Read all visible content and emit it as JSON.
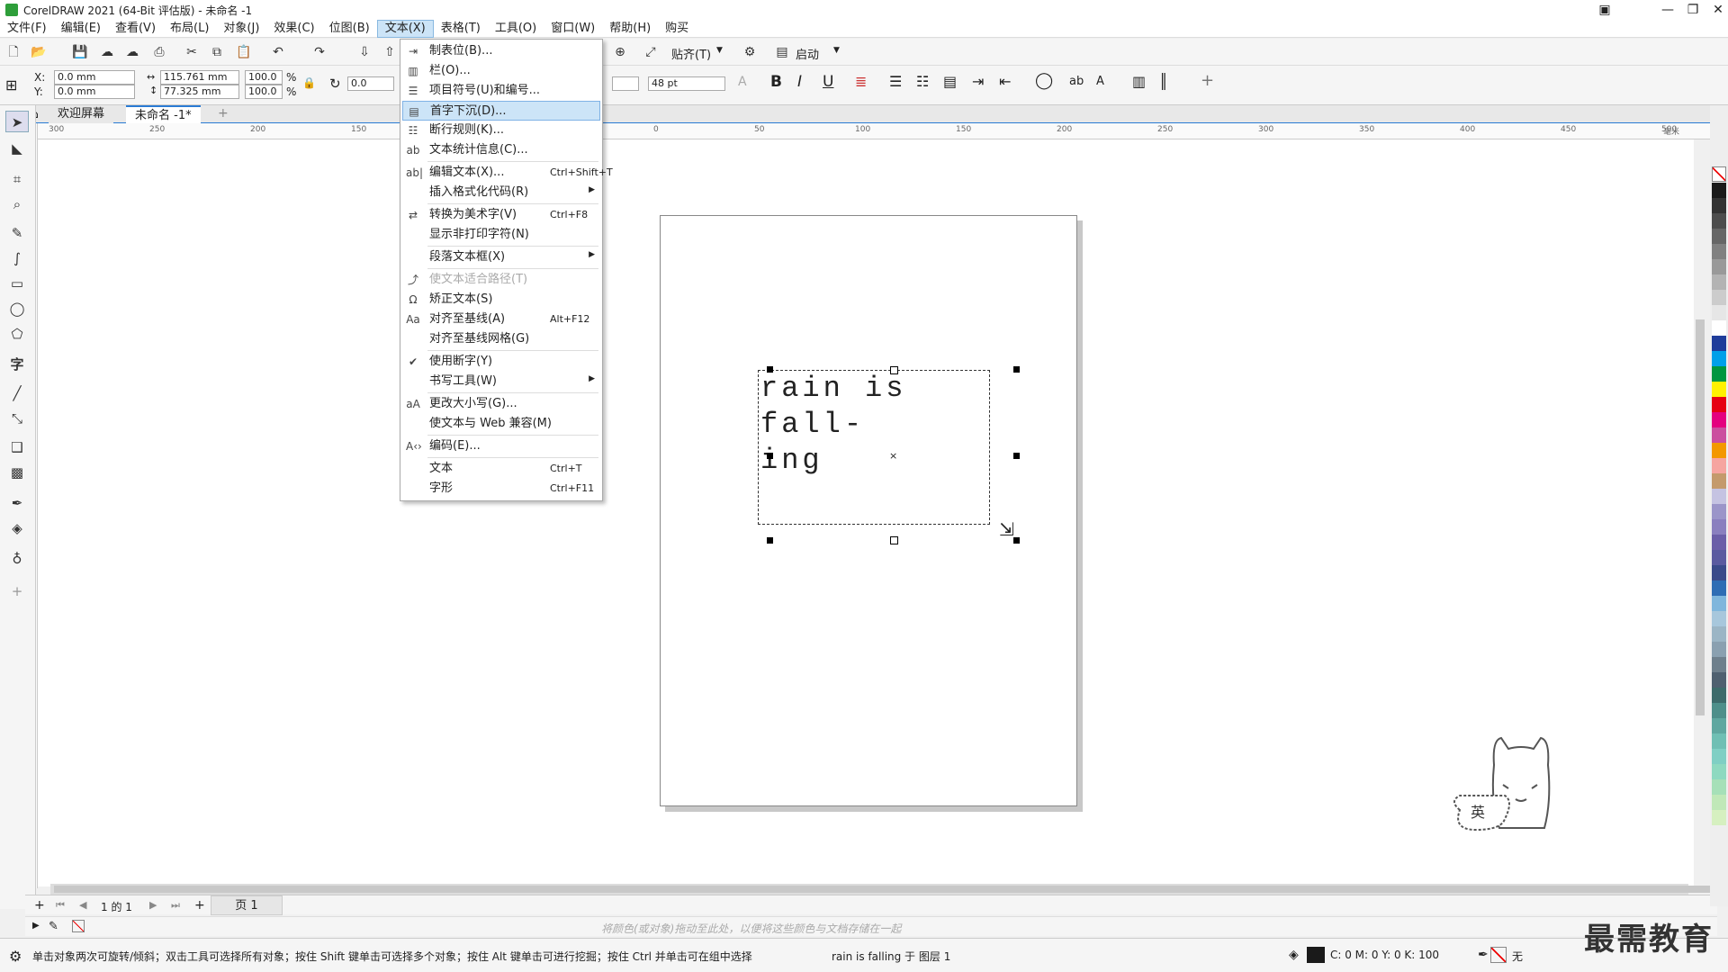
{
  "window": {
    "title": "CorelDRAW 2021 (64-Bit 评估版) - 未命名 -1"
  },
  "menubar": [
    "文件(F)",
    "编辑(E)",
    "查看(V)",
    "布局(L)",
    "对象(J)",
    "效果(C)",
    "位图(B)",
    "文本(X)",
    "表格(T)",
    "工具(O)",
    "窗口(W)",
    "帮助(H)",
    "购买"
  ],
  "toolbar": {
    "snap_label": "贴齐(T)",
    "launch_label": "启动"
  },
  "propbar": {
    "x_label": "X:",
    "x_value": "0.0 mm",
    "y_label": "Y:",
    "y_value": "0.0 mm",
    "w_value": "115.761 mm",
    "h_value": "77.325 mm",
    "sx": "100.0",
    "sy": "100.0",
    "pct": "%",
    "angle": "0.0",
    "font_size": "48 pt"
  },
  "tabs": {
    "welcome": "欢迎屏幕",
    "doc": "未命名 -1*"
  },
  "ruler": {
    "h": [
      "300",
      "250",
      "200",
      "150",
      "100",
      "50",
      "0",
      "50",
      "100",
      "150",
      "200",
      "250",
      "300",
      "350",
      "400",
      "450",
      "500"
    ],
    "unit": "毫米"
  },
  "canvas": {
    "text_lines": [
      "rain is fall-",
      "ing"
    ]
  },
  "dropdown": {
    "items": [
      {
        "label": "制表位(B)...",
        "icon": "tab-icon",
        "sc": "",
        "sub": false,
        "dis": false,
        "check": false,
        "hl": false
      },
      {
        "label": "栏(O)...",
        "icon": "columns-icon",
        "sc": "",
        "sub": false,
        "dis": false,
        "check": false,
        "hl": false
      },
      {
        "label": "项目符号(U)和编号...",
        "icon": "bullet-icon",
        "sc": "",
        "sub": false,
        "dis": false,
        "check": false,
        "hl": false
      },
      {
        "label": "首字下沉(D)...",
        "icon": "dropcap-icon",
        "sc": "",
        "sub": false,
        "dis": false,
        "check": false,
        "hl": true
      },
      {
        "label": "断行规则(K)...",
        "icon": "linebreak-icon",
        "sc": "",
        "sub": false,
        "dis": false,
        "check": false,
        "hl": false
      },
      {
        "label": "文本统计信息(C)...",
        "icon": "stats-icon",
        "sc": "",
        "sub": false,
        "dis": false,
        "check": false,
        "hl": false
      },
      {
        "label": "编辑文本(X)...",
        "icon": "edit-text-icon",
        "sc": "Ctrl+Shift+T",
        "sub": false,
        "dis": false,
        "check": false,
        "hl": false
      },
      {
        "label": "插入格式化代码(R)",
        "icon": "",
        "sc": "",
        "sub": true,
        "dis": false,
        "check": false,
        "hl": false
      },
      {
        "label": "转换为美术字(V)",
        "icon": "convert-icon",
        "sc": "Ctrl+F8",
        "sub": false,
        "dis": false,
        "check": false,
        "hl": false
      },
      {
        "label": "显示非打印字符(N)",
        "icon": "",
        "sc": "",
        "sub": false,
        "dis": false,
        "check": false,
        "hl": false
      },
      {
        "label": "段落文本框(X)",
        "icon": "",
        "sc": "",
        "sub": true,
        "dis": false,
        "check": false,
        "hl": false
      },
      {
        "label": "使文本适合路径(T)",
        "icon": "fit-path-icon",
        "sc": "",
        "sub": false,
        "dis": true,
        "check": false,
        "hl": false
      },
      {
        "label": "矫正文本(S)",
        "icon": "straighten-icon",
        "sc": "",
        "sub": false,
        "dis": false,
        "check": false,
        "hl": false
      },
      {
        "label": "对齐至基线(A)",
        "icon": "baseline-icon",
        "sc": "Alt+F12",
        "sub": false,
        "dis": false,
        "check": false,
        "hl": false
      },
      {
        "label": "对齐至基线网格(G)",
        "icon": "",
        "sc": "",
        "sub": false,
        "dis": false,
        "check": false,
        "hl": false
      },
      {
        "label": "使用断字(Y)",
        "icon": "",
        "sc": "",
        "sub": false,
        "dis": false,
        "check": true,
        "hl": false
      },
      {
        "label": "书写工具(W)",
        "icon": "",
        "sc": "",
        "sub": true,
        "dis": false,
        "check": false,
        "hl": false
      },
      {
        "label": "更改大小写(G)...",
        "icon": "case-icon",
        "sc": "",
        "sub": false,
        "dis": false,
        "check": false,
        "hl": false
      },
      {
        "label": "使文本与 Web 兼容(M)",
        "icon": "",
        "sc": "",
        "sub": false,
        "dis": false,
        "check": false,
        "hl": false
      },
      {
        "label": "编码(E)...",
        "icon": "encoding-icon",
        "sc": "",
        "sub": false,
        "dis": false,
        "check": false,
        "hl": false
      },
      {
        "label": "文本",
        "icon": "",
        "sc": "Ctrl+T",
        "sub": false,
        "dis": false,
        "check": false,
        "hl": false
      },
      {
        "label": "字形",
        "icon": "",
        "sc": "Ctrl+F11",
        "sub": false,
        "dis": false,
        "check": false,
        "hl": false
      }
    ]
  },
  "pagenav": {
    "position": "1 的 1",
    "page_tab": "页 1"
  },
  "colorstrip": {
    "hint": "将颜色(或对象)拖动至此处，以便将这些颜色与文档存储在一起"
  },
  "status": {
    "hint": "单击对象两次可旋转/倾斜；双击工具可选择所有对象；按住 Shift 键单击可选择多个对象；按住 Alt 键单击可进行挖掘；按住 Ctrl 并单击可在组中选择",
    "object": "rain is falling 于 图层 1",
    "cmyk": "C: 0 M: 0 Y: 0 K: 100",
    "none": "无"
  },
  "mascot": {
    "badge": "英"
  },
  "watermark": "最需教育",
  "palette": [
    "#1a1a1a",
    "#333333",
    "#4d4d4d",
    "#666666",
    "#808080",
    "#999999",
    "#b3b3b3",
    "#cccccc",
    "#e6e6e6",
    "#ffffff",
    "#1f3c9a",
    "#00a0e9",
    "#00963f",
    "#fff100",
    "#e60012",
    "#e4007f",
    "#cb4f9f",
    "#f39800",
    "#f6a5a0",
    "#c49a6c",
    "#c5c3e2",
    "#9b95c9",
    "#8a7fbf",
    "#6b5ea8",
    "#5a5aa0",
    "#3a4a8a",
    "#2e6db4",
    "#7fb6dc",
    "#a7c7dc",
    "#9bb5c5",
    "#8aa0b0",
    "#6e7f8c",
    "#4f6070",
    "#3d6b6b",
    "#4e8f8a",
    "#5fa7a0",
    "#6fbfb4",
    "#7fcfc4",
    "#8ed9c0",
    "#a6e0b8",
    "#c0e8b8",
    "#d6f0c0"
  ]
}
